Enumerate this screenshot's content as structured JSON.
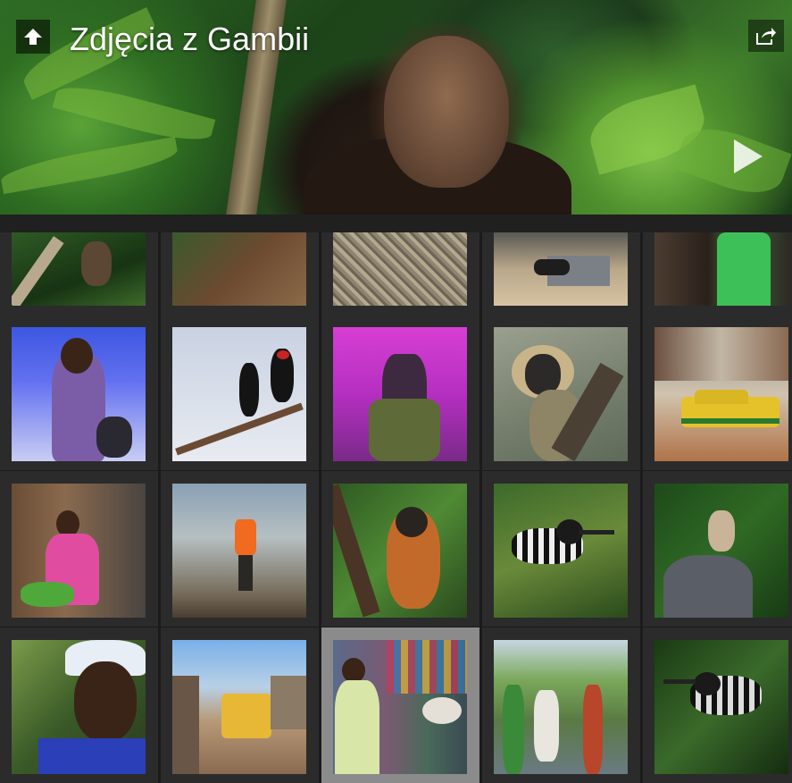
{
  "header": {
    "title": "Zdjęcia z Gambii",
    "up_icon": "arrow-up-icon",
    "share_icon": "share-icon",
    "play_icon": "play-icon"
  },
  "gallery": {
    "rows": 4,
    "columns": 5,
    "selected_index": 17
  }
}
